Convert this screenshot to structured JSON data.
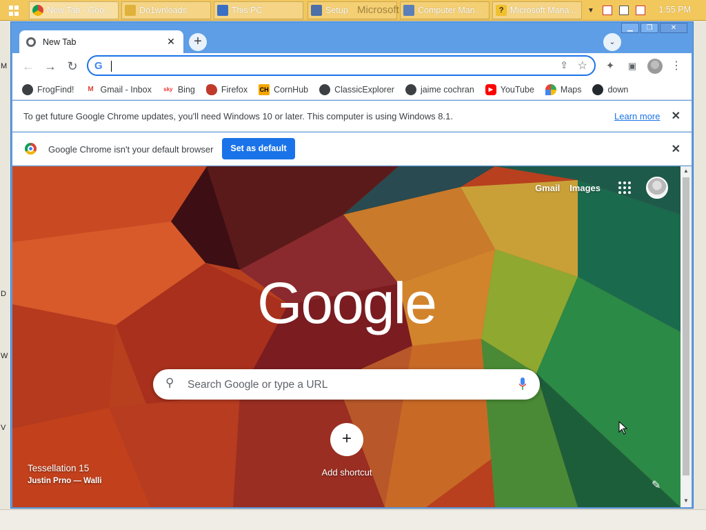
{
  "taskbar": {
    "tasks": [
      {
        "label": "New Tab - Goo...",
        "icon": "chrome-icon",
        "color": "#db4437"
      },
      {
        "label": "Do1wnloads",
        "icon": "folder-icon",
        "color": "#e0b23c"
      },
      {
        "label": "This PC",
        "icon": "computer-icon",
        "color": "#3b6fc4"
      },
      {
        "label": "Setup",
        "icon": "setup-icon",
        "color": "#4d6fa8"
      },
      {
        "label": "Computer Man...",
        "icon": "management-icon",
        "color": "#5b7fb8"
      },
      {
        "label": "Microsoft Mana...",
        "icon": "help-icon",
        "color": "#f0c030"
      }
    ],
    "ghost_title": "Microsoft",
    "clock": "1:55 PM"
  },
  "desktop": {
    "edge_letters": [
      "M",
      "D",
      "W",
      "V"
    ]
  },
  "tab": {
    "title": "New Tab"
  },
  "omnibox": {
    "value": "",
    "placeholder": ""
  },
  "bookmarks": [
    {
      "label": "FrogFind!",
      "icon": "globe-icon",
      "color": "#3c4043",
      "glyph": ""
    },
    {
      "label": "Gmail - Inbox",
      "icon": "gmail-icon",
      "color": "#ffffff",
      "glyph": "M"
    },
    {
      "label": "Bing",
      "icon": "sky-icon",
      "color": "#ffffff",
      "glyph": "sky"
    },
    {
      "label": "Firefox",
      "icon": "firefox-icon",
      "color": "#c0392b",
      "glyph": ""
    },
    {
      "label": "CornHub",
      "icon": "cornhub-icon",
      "color": "#f7a600",
      "glyph": "CH"
    },
    {
      "label": "ClassicExplorer",
      "icon": "globe-icon",
      "color": "#3c4043",
      "glyph": ""
    },
    {
      "label": "jaime cochran",
      "icon": "globe-icon",
      "color": "#3c4043",
      "glyph": ""
    },
    {
      "label": "YouTube",
      "icon": "youtube-icon",
      "color": "#ff0000",
      "glyph": "▶"
    },
    {
      "label": "Maps",
      "icon": "maps-icon",
      "color": "#34a853",
      "glyph": ""
    },
    {
      "label": "down",
      "icon": "github-icon",
      "color": "#24292e",
      "glyph": ""
    }
  ],
  "update_bar": {
    "message": "To get future Google Chrome updates, you'll need Windows 10 or later. This computer is using Windows 8.1.",
    "link": "Learn more"
  },
  "default_bar": {
    "message": "Google Chrome isn't your default browser",
    "button": "Set as default"
  },
  "ntp": {
    "links": [
      "Gmail",
      "Images"
    ],
    "logo": "Google",
    "search_placeholder": "Search Google or type a URL",
    "shortcut_label": "Add shortcut",
    "shortcut_glyph": "+",
    "attribution_title": "Tessellation 15",
    "attribution_author": "Justin Prno — Walli"
  },
  "colors": {
    "accent": "#1a73e8",
    "frame": "#5d9ee6",
    "taskbar": "#f2c75c"
  }
}
